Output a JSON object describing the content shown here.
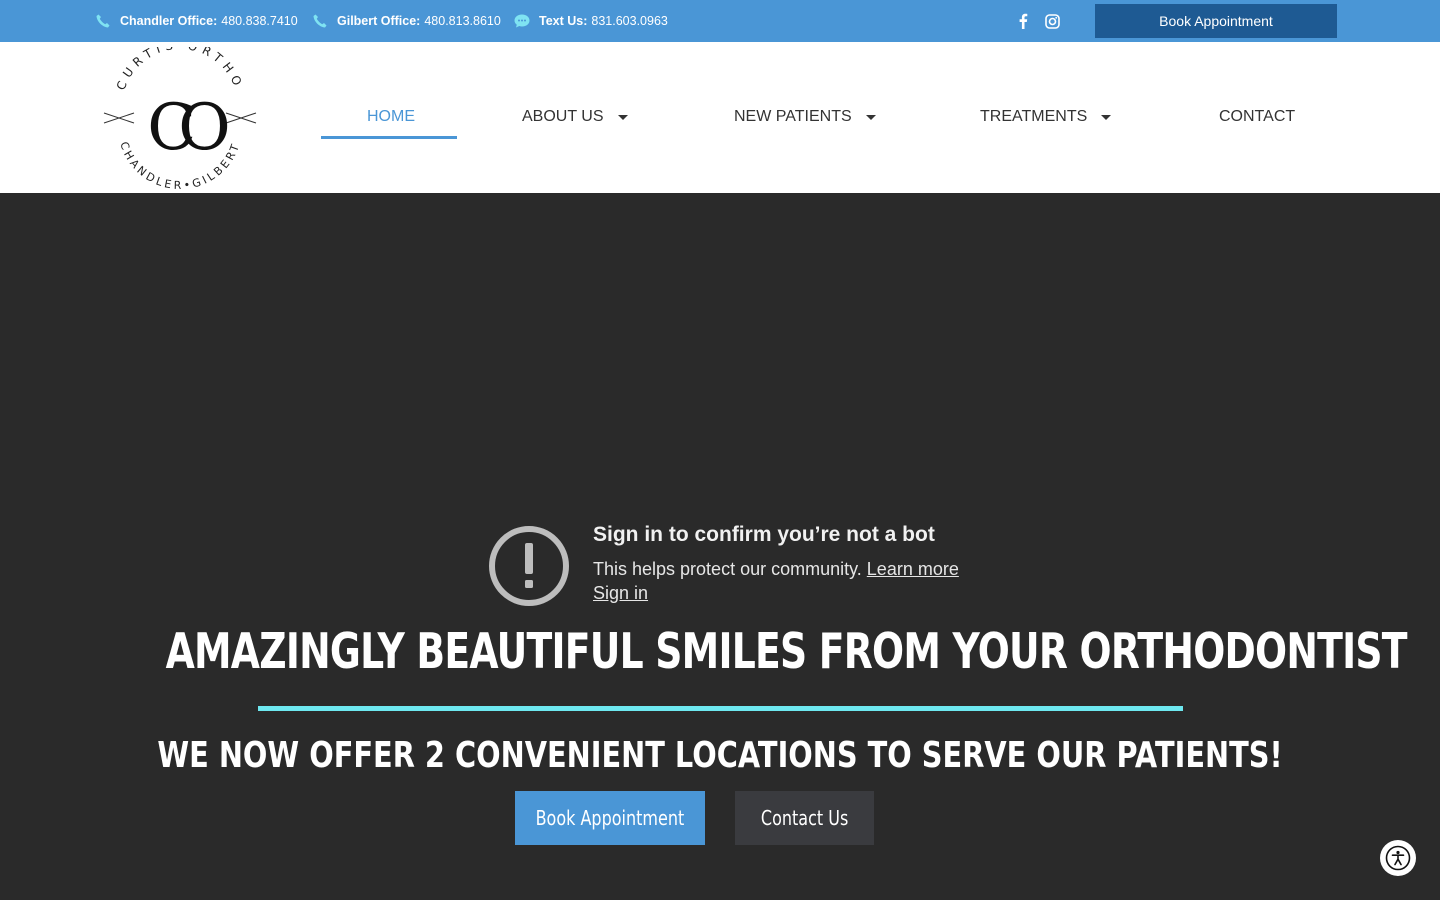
{
  "topbar": {
    "chandler_label": "Chandler Office:",
    "chandler_phone": "480.838.7410",
    "gilbert_label": "Gilbert Office:",
    "gilbert_phone": "480.813.8610",
    "text_label": "Text Us:",
    "text_phone": "831.603.0963",
    "book_label": "Book Appointment",
    "icons": [
      "phone-icon",
      "phone-icon",
      "sms-icon",
      "facebook-icon",
      "instagram-icon"
    ]
  },
  "logo": {
    "monogram": "CO",
    "arc_top": "CURTIS ORTHO",
    "arc_bottom": "CHANDLER•GILBERT"
  },
  "nav": {
    "home": "HOME",
    "about": "ABOUT US",
    "new_patients": "NEW PATIENTS",
    "treatments": "TREATMENTS",
    "contact": "CONTACT"
  },
  "video_notice": {
    "title": "Sign in to confirm you’re not a bot",
    "message": "This helps protect our community.",
    "learn_more": "Learn more",
    "sign_in": "Sign in"
  },
  "hero": {
    "headline": "AMAZINGLY BEAUTIFUL SMILES FROM YOUR ORTHODONTIST",
    "subhead": "WE NOW OFFER 2 CONVENIENT LOCATIONS TO SERVE OUR PATIENTS!",
    "book_button": "Book Appointment",
    "contact_button": "Contact Us"
  },
  "colors": {
    "topbar": "#4a96d6",
    "book_top": "#1e5a93",
    "accent_line": "#6ee8f0",
    "hero_bg": "#2a2a2a",
    "nav_active": "#4a96d6"
  }
}
